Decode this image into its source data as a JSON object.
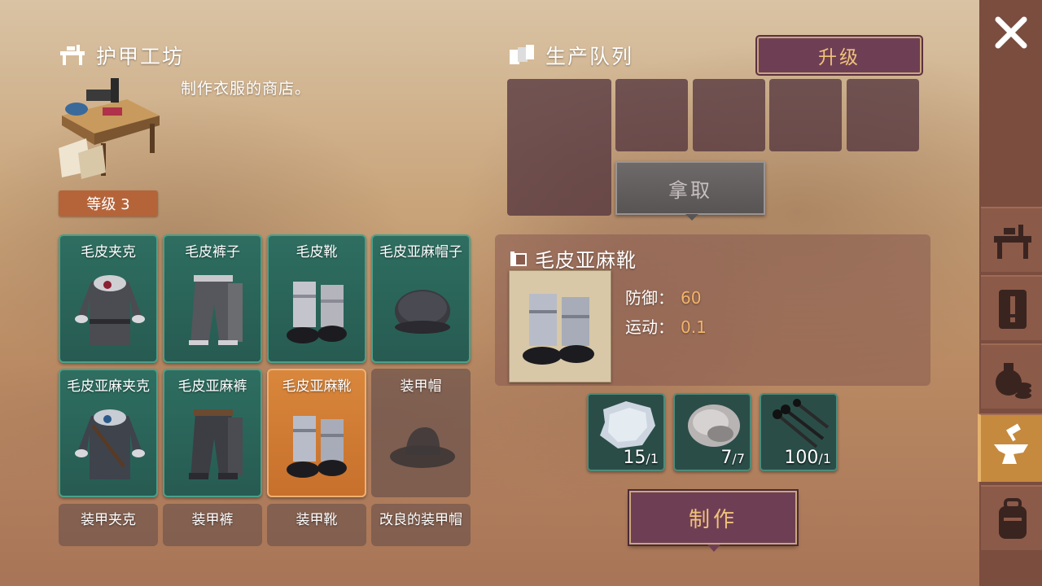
{
  "workshop": {
    "title": "护甲工坊",
    "description": "制作衣服的商店。",
    "level_label": "等级 3"
  },
  "items": [
    {
      "name": "毛皮夹克",
      "state": "available"
    },
    {
      "name": "毛皮裤子",
      "state": "available"
    },
    {
      "name": "毛皮靴",
      "state": "available"
    },
    {
      "name": "毛皮亚麻帽子",
      "state": "available"
    },
    {
      "name": "毛皮亚麻夹克",
      "state": "available"
    },
    {
      "name": "毛皮亚麻裤",
      "state": "available"
    },
    {
      "name": "毛皮亚麻靴",
      "state": "selected"
    },
    {
      "name": "装甲帽",
      "state": "locked"
    },
    {
      "name": "装甲夹克",
      "state": "locked"
    },
    {
      "name": "装甲裤",
      "state": "locked"
    },
    {
      "name": "装甲靴",
      "state": "locked"
    },
    {
      "name": "改良的装甲帽",
      "state": "locked"
    }
  ],
  "queue": {
    "title": "生产队列",
    "upgrade_label": "升级",
    "take_label": "拿取"
  },
  "detail": {
    "title": "毛皮亚麻靴",
    "defense_label": "防御：",
    "defense_value": "60",
    "movement_label": "运动：",
    "movement_value": "0.1"
  },
  "materials": [
    {
      "icon": "hide-icon",
      "have": "15",
      "need": "/1"
    },
    {
      "icon": "fur-icon",
      "have": "7",
      "need": "/7"
    },
    {
      "icon": "nails-icon",
      "have": "100",
      "need": "/1"
    }
  ],
  "craft_label": "制作",
  "colors": {
    "accent": "#f0c27a",
    "selected_card": "#d9873c",
    "card": "#2e6e61"
  }
}
